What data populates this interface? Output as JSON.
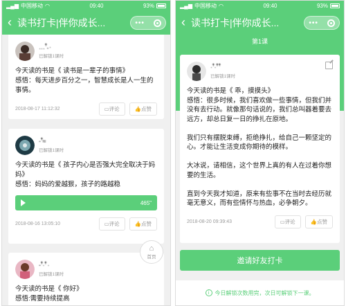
{
  "status": {
    "carrier": "中国移动",
    "time": "09:40",
    "battery": "93%"
  },
  "nav": {
    "back_glyph": "‹",
    "title_left": "读书打卡|伴你成长...",
    "title_right": "读书打卡|伴你成长...",
    "capsule_dots": "•••"
  },
  "left_feed": [
    {
      "user": "…ꜛ˖ ·",
      "unlocked": "已解锁1课时",
      "text": "今天读的书是《 读书是一辈子的事情》\n感悟：每天进步百分之一，智慧成长是人一生的事情。",
      "time": "2018-08-17 11:12:32",
      "comment": "评论",
      "like": "点赞"
    },
    {
      "user": "-ꜛ≈",
      "unlocked": "已解锁1课时",
      "text": "今天读的书是《 孩子内心是否强大完全取决于妈妈》\n感悟：妈妈的爱越狠，孩子的路越稳",
      "audio_duration": "465\"",
      "time": "2018-08-16 13:05:10",
      "comment": "评论",
      "like": "点赞"
    },
    {
      "user": "-ꜛ·ꜛ ·",
      "unlocked": "已解锁1课时",
      "text": "今天读的书是《 你好》\n感悟:需要持续提高"
    }
  ],
  "home_fab": {
    "label": "首页",
    "icon": "home-icon"
  },
  "right_detail": {
    "lesson_label": "第1课",
    "user": "·ꜛ·ꜛꜛ",
    "unlocked": "已解锁1课时",
    "text": "今天读的书是《 乖，摸摸头》\n感悟：很多时候，我们喜欢做一些事情，但我们并没有去行动。就像那句话说的，我们总叫器着要去远方，却总日复一日的挣扎在原地。\n\n我们只有摆脱束缚，拒绝挣扎，给自己一颗坚定的心。才能让生活变成你期待的模样。\n\n大冰说，请相信，这个世界上真的有人在过着你想要的生活。\n\n直到今天我才知道，原来有些事不在当时去经历就毫无意义，而有些情怀与热血，必争朝夕。",
    "time": "2018-08-20 09:39:43",
    "comment": "评论",
    "like": "点赞"
  },
  "invite_button": "邀请好友打卡",
  "notice": "今日解锁次数用完，次日可解锁下一课。",
  "colors": {
    "accent": "#5bcf7a",
    "bg": "#f0f0f0"
  }
}
